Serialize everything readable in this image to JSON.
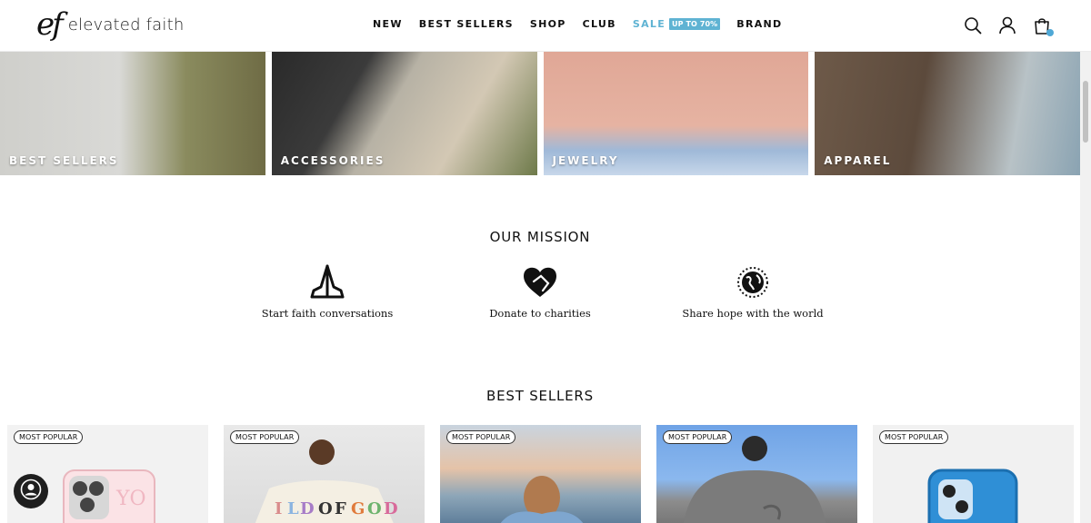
{
  "header": {
    "logo_mark": "ef",
    "logo_text": "elevated faith",
    "nav": [
      {
        "label": "NEW"
      },
      {
        "label": "BEST SELLERS"
      },
      {
        "label": "SHOP"
      },
      {
        "label": "CLUB"
      },
      {
        "label": "SALE",
        "badge": "UP TO 70%"
      },
      {
        "label": "BRAND"
      }
    ],
    "icons": [
      "search-icon",
      "account-icon",
      "cart-icon"
    ]
  },
  "categories": [
    {
      "label": "BEST SELLERS"
    },
    {
      "label": "ACCESSORIES"
    },
    {
      "label": "JEWELRY"
    },
    {
      "label": "APPAREL"
    }
  ],
  "mission": {
    "title": "OUR MISSION",
    "items": [
      {
        "text": "Start faith conversations",
        "icon": "praying-hands-icon"
      },
      {
        "text": "Donate to charities",
        "icon": "heart-hand-icon"
      },
      {
        "text": "Share hope with the world",
        "icon": "globe-icon"
      }
    ]
  },
  "best_sellers": {
    "title": "BEST SELLERS",
    "products": [
      {
        "badge": "MOST POPULAR"
      },
      {
        "badge": "MOST POPULAR"
      },
      {
        "badge": "MOST POPULAR"
      },
      {
        "badge": "MOST POPULAR"
      },
      {
        "badge": "MOST POPULAR"
      }
    ]
  },
  "colors": {
    "accent": "#5fb3d3",
    "cart_dot": "#4fa8d6",
    "text": "#111111"
  }
}
